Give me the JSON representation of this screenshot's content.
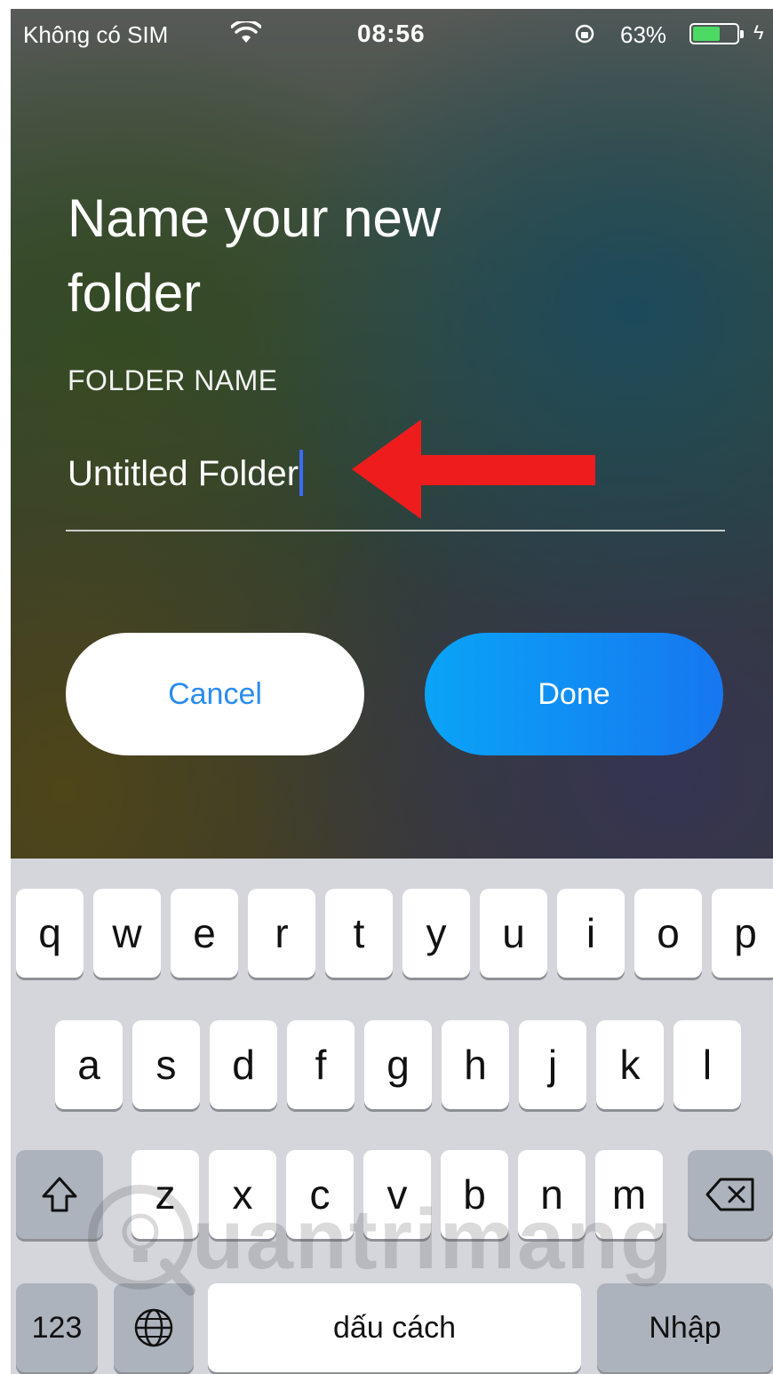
{
  "status_bar": {
    "carrier": "Không có SIM",
    "time": "08:56",
    "battery_percent": "63%",
    "battery_level": 0.63,
    "battery_color": "#4cd964"
  },
  "dialog": {
    "title_line1": "Name your new",
    "title_line2": "folder",
    "field_label": "FOLDER NAME",
    "field_value": "Untitled Folder",
    "cancel_label": "Cancel",
    "done_label": "Done",
    "cancel_color": "#2a8cf0",
    "done_color": "#1677f0",
    "annotation_arrow_color": "#ee1c1c"
  },
  "keyboard": {
    "row1": [
      "q",
      "w",
      "e",
      "r",
      "t",
      "y",
      "u",
      "i",
      "o",
      "p"
    ],
    "row2": [
      "a",
      "s",
      "d",
      "f",
      "g",
      "h",
      "j",
      "k",
      "l"
    ],
    "row3": [
      "z",
      "x",
      "c",
      "v",
      "b",
      "n",
      "m"
    ],
    "numbers_label": "123",
    "space_label": "dấu cách",
    "return_label": "Nhập",
    "icons": {
      "shift": "shift-icon",
      "delete": "backspace-icon",
      "language": "globe-icon"
    }
  },
  "watermark": {
    "text": "uantrimang",
    "icon": "lightbulb-q-icon"
  }
}
